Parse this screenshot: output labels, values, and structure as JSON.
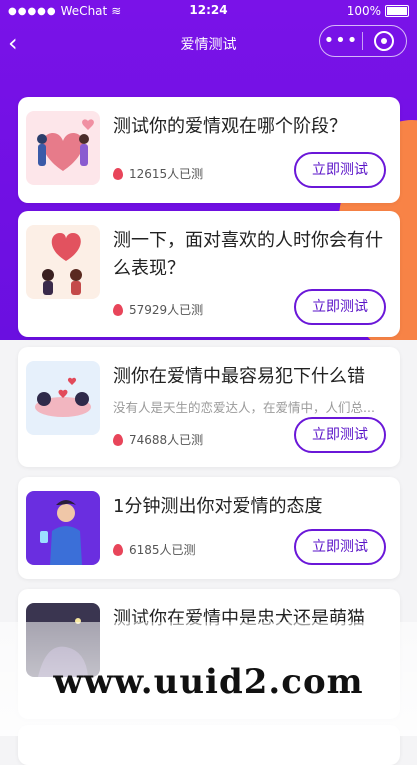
{
  "statusbar": {
    "carrier": "WeChat",
    "time": "12:24",
    "battery": "100%"
  },
  "navbar": {
    "title": "爱情测试"
  },
  "cards": [
    {
      "title": "测试你的爱情观在哪个阶段？",
      "desc": "",
      "count": "12615人已测",
      "button": "立即测试"
    },
    {
      "title": "测一下，面对喜欢的人时你会有什么表现？",
      "desc": "",
      "count": "57929人已测",
      "button": "立即测试"
    },
    {
      "title": "测你在爱情中最容易犯下什么错",
      "desc": "没有人是天生的恋爱达人，在爱情中，人们总...",
      "count": "74688人已测",
      "button": "立即测试"
    },
    {
      "title": "1分钟测出你对爱情的态度",
      "desc": "",
      "count": "6185人已测",
      "button": "立即测试"
    },
    {
      "title": "测试你在爱情中是忠犬还是萌猫",
      "desc": "",
      "count": "",
      "button": ""
    }
  ],
  "watermark": "www.uuid2.com"
}
